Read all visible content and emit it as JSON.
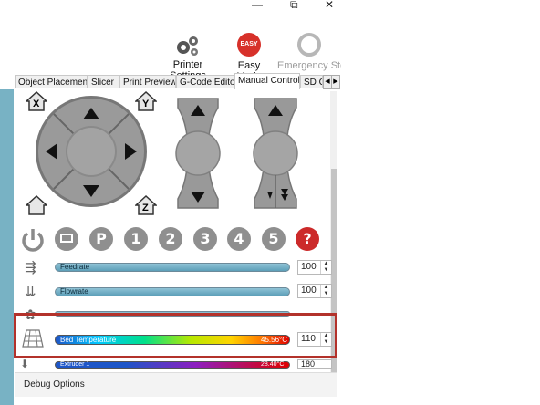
{
  "window": {
    "minimize": "—",
    "maximize": "⧉",
    "close": "✕"
  },
  "toolbar": {
    "printer_settings": "Printer Settings",
    "easy_mode": "Easy Mode",
    "easy_badge": "EASY",
    "emergency_stop": "Emergency Sto"
  },
  "tabs": [
    "Object Placement",
    "Slicer",
    "Print Preview",
    "G-Code Editor",
    "Manual Control",
    "SD C"
  ],
  "active_tab": "Manual Control",
  "jog": {
    "x_home": "X",
    "y_home": "Y",
    "z_home": "Z"
  },
  "buttons": [
    "P",
    "1",
    "2",
    "3",
    "4",
    "5",
    "?"
  ],
  "sliders": [
    {
      "label": "Feedrate",
      "value": "100"
    },
    {
      "label": "Flowrate",
      "value": "100"
    },
    {
      "label": "",
      "value": ""
    },
    {
      "label": "Bed Temperature",
      "temp": "45.56°C",
      "value": "110"
    },
    {
      "label": "Extruder 1",
      "temp": "28.40°C",
      "value": "180"
    }
  ],
  "debug": "Debug Options",
  "colors": {
    "highlight": "#b3322b",
    "accent_blue": "#1e56c8",
    "gray_button": "#8f8f8f",
    "help_red": "#cc2a2a"
  }
}
